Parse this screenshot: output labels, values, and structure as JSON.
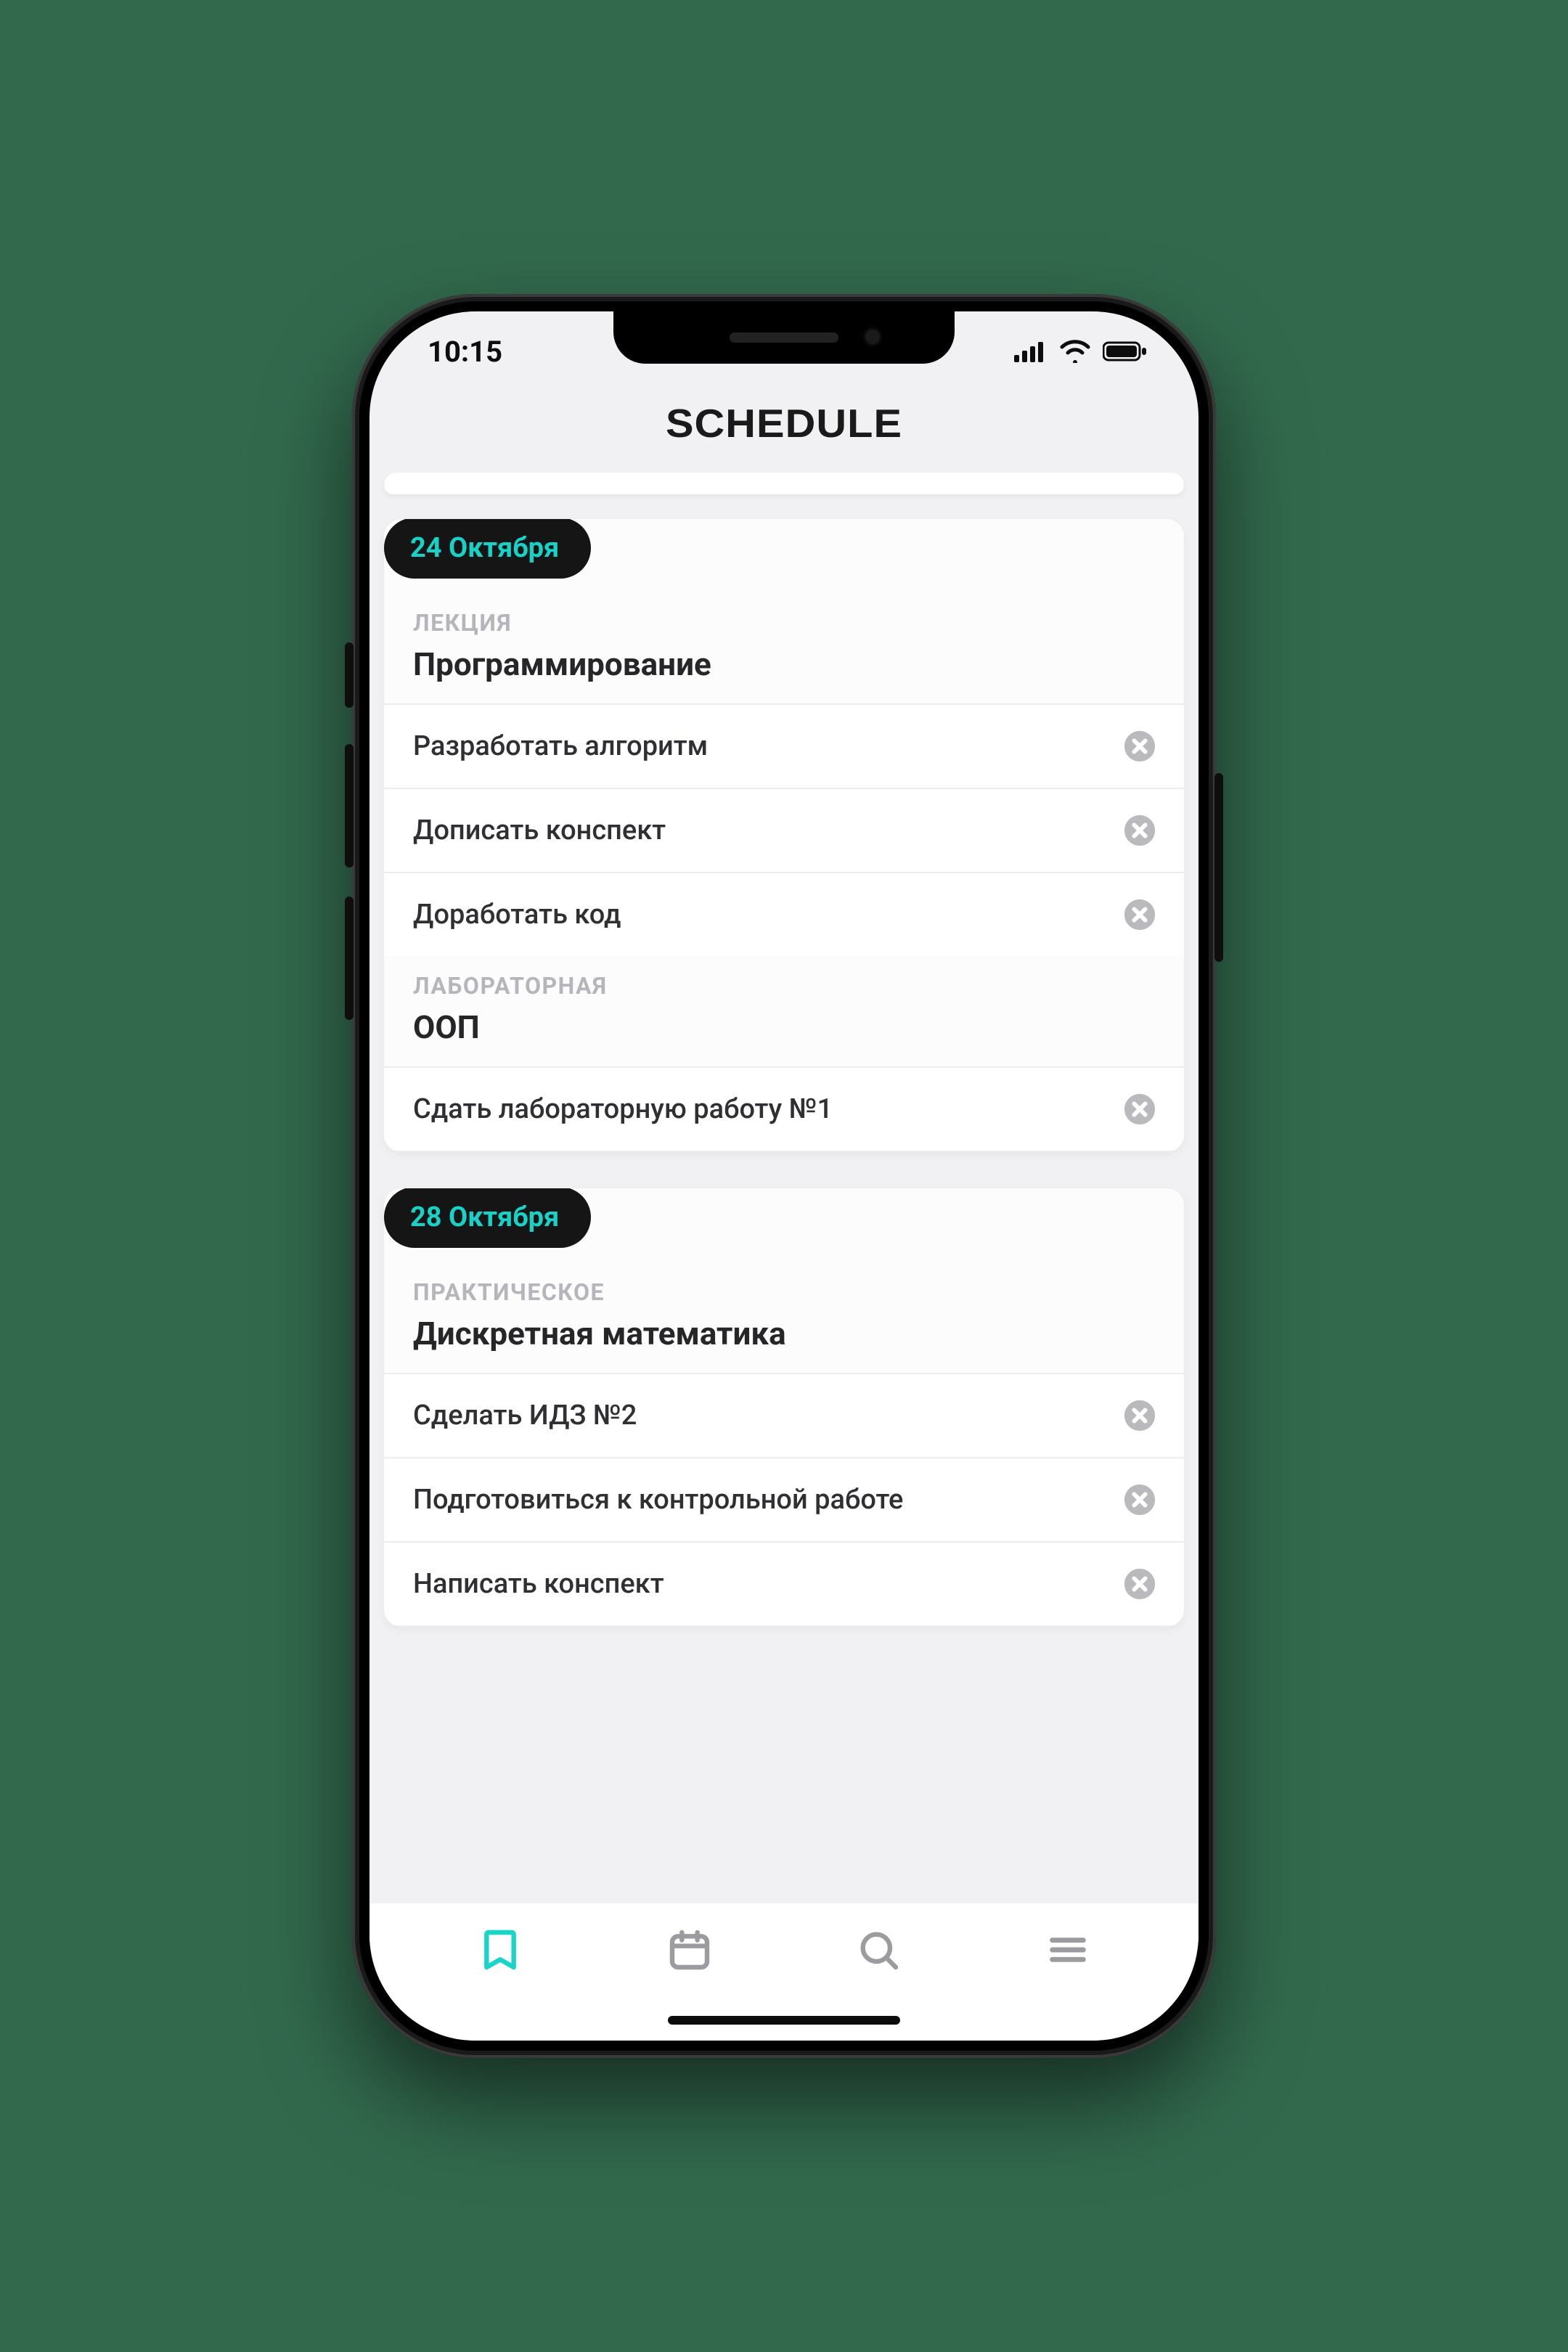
{
  "status": {
    "time": "10:15"
  },
  "header": {
    "title": "SCHEDULE"
  },
  "days": [
    {
      "date": "24 Октября",
      "sections": [
        {
          "type": "ЛЕКЦИЯ",
          "title": "Программирование",
          "tasks": [
            "Разработать алгоритм",
            "Дописать конспект",
            "Доработать код"
          ]
        },
        {
          "type": "ЛАБОРАТОРНАЯ",
          "title": "ООП",
          "tasks": [
            "Сдать лабораторную работу №1"
          ]
        }
      ]
    },
    {
      "date": "28 Октября",
      "sections": [
        {
          "type": "ПРАКТИЧЕСКОЕ",
          "title": "Дискретная математика",
          "tasks": [
            "Сделать ИДЗ №2",
            "Подготовиться к контрольной работе",
            "Написать конспект"
          ]
        }
      ]
    }
  ],
  "tabs": {
    "bookmark": "bookmark-icon",
    "calendar": "calendar-icon",
    "search": "search-icon",
    "menu": "menu-icon"
  },
  "colors": {
    "accent": "#17d2c6",
    "bg": "#f1f1f3",
    "text": "#262629",
    "muted": "#b5b5bb"
  }
}
